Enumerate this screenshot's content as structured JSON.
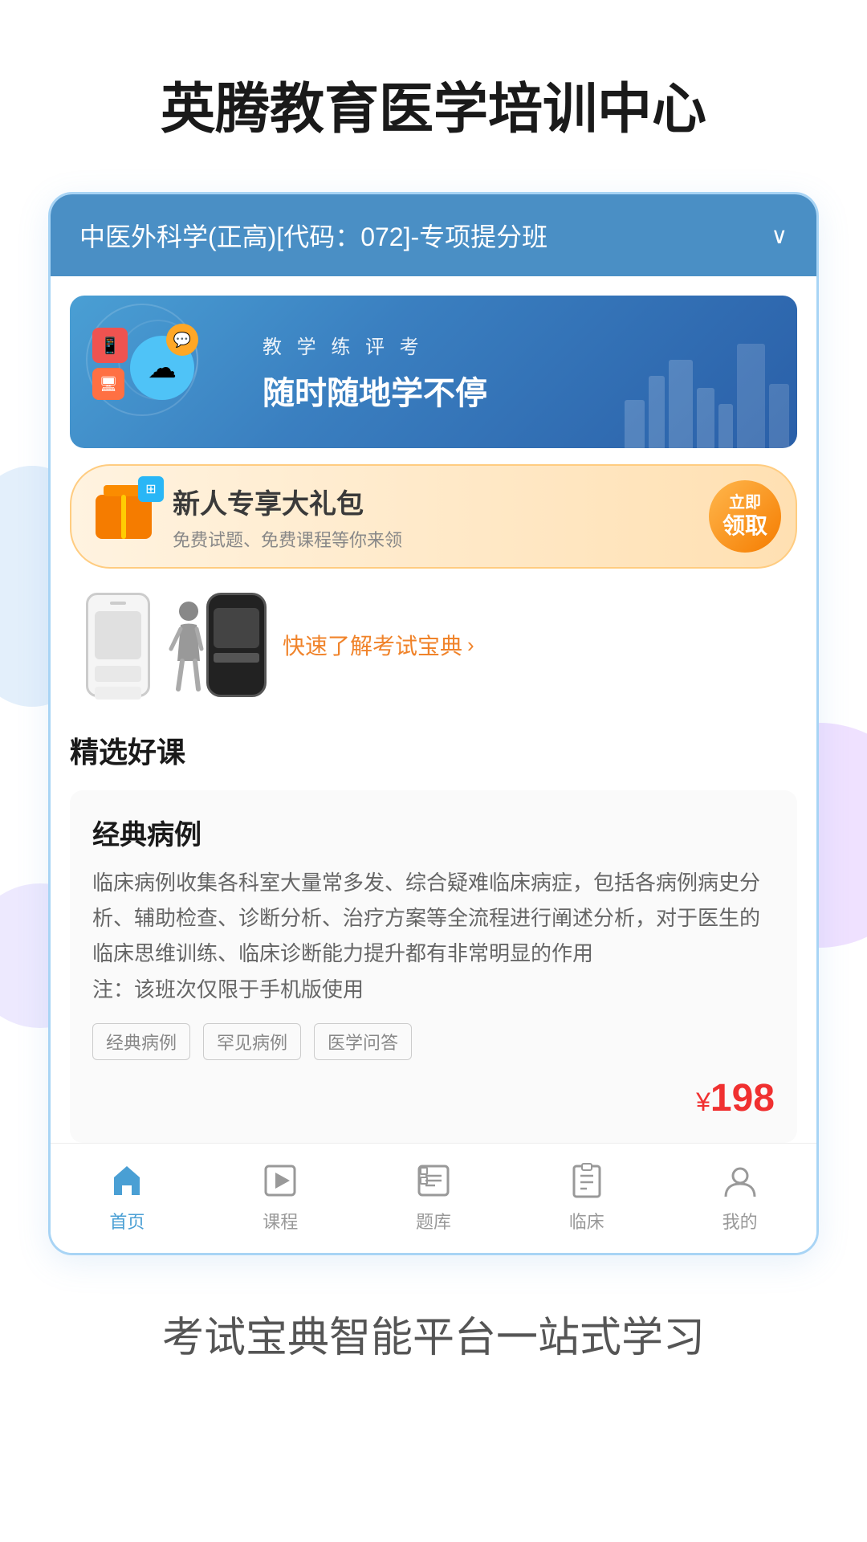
{
  "page": {
    "title": "英腾教育医学培训中心",
    "bottom_subtitle": "考试宝典智能平台一站式学习"
  },
  "course_selector": {
    "text": "中医外科学(正高)[代码：072]-专项提分班",
    "chevron": "∨"
  },
  "banner": {
    "subtitle": "教 学 练 评 考",
    "title": "随时随地学不停"
  },
  "gift_banner": {
    "title": "新人专享大礼包",
    "desc": "免费试题、免费课程等你来领",
    "btn_line1": "立即",
    "btn_line2": "领取"
  },
  "exam_promo": {
    "link_text": "快速了解考试宝典",
    "arrow": "›"
  },
  "courses_section": {
    "title": "精选好课",
    "course": {
      "name": "经典病例",
      "description": "临床病例收集各科室大量常多发、综合疑难临床病症，包括各病例病史分析、辅助检查、诊断分析、治疗方案等全流程进行阐述分析，对于医生的临床思维训练、临床诊断能力提升都有非常明显的作用\n注：该班次仅限于手机版使用",
      "tags": [
        "经典病例",
        "罕见病例",
        "医学问答"
      ],
      "price": "198",
      "price_symbol": "¥"
    }
  },
  "nav": {
    "items": [
      {
        "label": "首页",
        "active": true,
        "icon": "home-icon"
      },
      {
        "label": "课程",
        "active": false,
        "icon": "course-icon"
      },
      {
        "label": "题库",
        "active": false,
        "icon": "quiz-icon"
      },
      {
        "label": "临床",
        "active": false,
        "icon": "clinical-icon"
      },
      {
        "label": "我的",
        "active": false,
        "icon": "my-icon"
      }
    ]
  }
}
